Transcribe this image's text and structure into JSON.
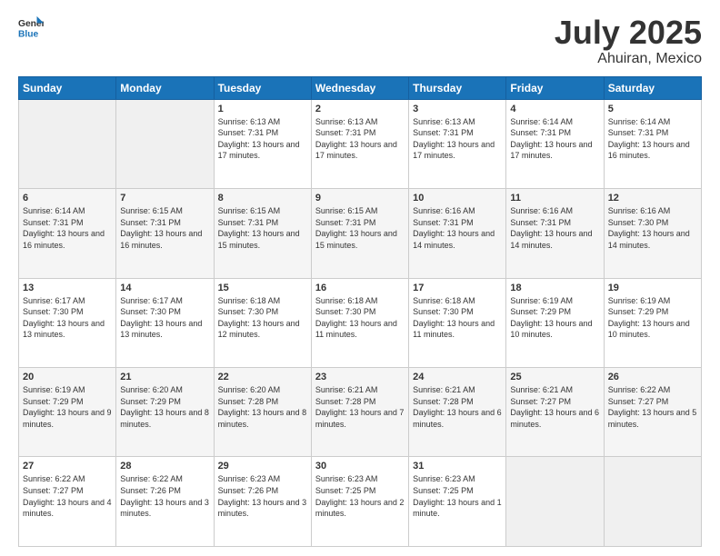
{
  "logo": {
    "general": "General",
    "blue": "Blue"
  },
  "header": {
    "month": "July 2025",
    "location": "Ahuiran, Mexico"
  },
  "weekdays": [
    "Sunday",
    "Monday",
    "Tuesday",
    "Wednesday",
    "Thursday",
    "Friday",
    "Saturday"
  ],
  "weeks": [
    [
      {
        "day": "",
        "sunrise": "",
        "sunset": "",
        "daylight": ""
      },
      {
        "day": "",
        "sunrise": "",
        "sunset": "",
        "daylight": ""
      },
      {
        "day": "1",
        "sunrise": "Sunrise: 6:13 AM",
        "sunset": "Sunset: 7:31 PM",
        "daylight": "Daylight: 13 hours and 17 minutes."
      },
      {
        "day": "2",
        "sunrise": "Sunrise: 6:13 AM",
        "sunset": "Sunset: 7:31 PM",
        "daylight": "Daylight: 13 hours and 17 minutes."
      },
      {
        "day": "3",
        "sunrise": "Sunrise: 6:13 AM",
        "sunset": "Sunset: 7:31 PM",
        "daylight": "Daylight: 13 hours and 17 minutes."
      },
      {
        "day": "4",
        "sunrise": "Sunrise: 6:14 AM",
        "sunset": "Sunset: 7:31 PM",
        "daylight": "Daylight: 13 hours and 17 minutes."
      },
      {
        "day": "5",
        "sunrise": "Sunrise: 6:14 AM",
        "sunset": "Sunset: 7:31 PM",
        "daylight": "Daylight: 13 hours and 16 minutes."
      }
    ],
    [
      {
        "day": "6",
        "sunrise": "Sunrise: 6:14 AM",
        "sunset": "Sunset: 7:31 PM",
        "daylight": "Daylight: 13 hours and 16 minutes."
      },
      {
        "day": "7",
        "sunrise": "Sunrise: 6:15 AM",
        "sunset": "Sunset: 7:31 PM",
        "daylight": "Daylight: 13 hours and 16 minutes."
      },
      {
        "day": "8",
        "sunrise": "Sunrise: 6:15 AM",
        "sunset": "Sunset: 7:31 PM",
        "daylight": "Daylight: 13 hours and 15 minutes."
      },
      {
        "day": "9",
        "sunrise": "Sunrise: 6:15 AM",
        "sunset": "Sunset: 7:31 PM",
        "daylight": "Daylight: 13 hours and 15 minutes."
      },
      {
        "day": "10",
        "sunrise": "Sunrise: 6:16 AM",
        "sunset": "Sunset: 7:31 PM",
        "daylight": "Daylight: 13 hours and 14 minutes."
      },
      {
        "day": "11",
        "sunrise": "Sunrise: 6:16 AM",
        "sunset": "Sunset: 7:31 PM",
        "daylight": "Daylight: 13 hours and 14 minutes."
      },
      {
        "day": "12",
        "sunrise": "Sunrise: 6:16 AM",
        "sunset": "Sunset: 7:30 PM",
        "daylight": "Daylight: 13 hours and 14 minutes."
      }
    ],
    [
      {
        "day": "13",
        "sunrise": "Sunrise: 6:17 AM",
        "sunset": "Sunset: 7:30 PM",
        "daylight": "Daylight: 13 hours and 13 minutes."
      },
      {
        "day": "14",
        "sunrise": "Sunrise: 6:17 AM",
        "sunset": "Sunset: 7:30 PM",
        "daylight": "Daylight: 13 hours and 13 minutes."
      },
      {
        "day": "15",
        "sunrise": "Sunrise: 6:18 AM",
        "sunset": "Sunset: 7:30 PM",
        "daylight": "Daylight: 13 hours and 12 minutes."
      },
      {
        "day": "16",
        "sunrise": "Sunrise: 6:18 AM",
        "sunset": "Sunset: 7:30 PM",
        "daylight": "Daylight: 13 hours and 11 minutes."
      },
      {
        "day": "17",
        "sunrise": "Sunrise: 6:18 AM",
        "sunset": "Sunset: 7:30 PM",
        "daylight": "Daylight: 13 hours and 11 minutes."
      },
      {
        "day": "18",
        "sunrise": "Sunrise: 6:19 AM",
        "sunset": "Sunset: 7:29 PM",
        "daylight": "Daylight: 13 hours and 10 minutes."
      },
      {
        "day": "19",
        "sunrise": "Sunrise: 6:19 AM",
        "sunset": "Sunset: 7:29 PM",
        "daylight": "Daylight: 13 hours and 10 minutes."
      }
    ],
    [
      {
        "day": "20",
        "sunrise": "Sunrise: 6:19 AM",
        "sunset": "Sunset: 7:29 PM",
        "daylight": "Daylight: 13 hours and 9 minutes."
      },
      {
        "day": "21",
        "sunrise": "Sunrise: 6:20 AM",
        "sunset": "Sunset: 7:29 PM",
        "daylight": "Daylight: 13 hours and 8 minutes."
      },
      {
        "day": "22",
        "sunrise": "Sunrise: 6:20 AM",
        "sunset": "Sunset: 7:28 PM",
        "daylight": "Daylight: 13 hours and 8 minutes."
      },
      {
        "day": "23",
        "sunrise": "Sunrise: 6:21 AM",
        "sunset": "Sunset: 7:28 PM",
        "daylight": "Daylight: 13 hours and 7 minutes."
      },
      {
        "day": "24",
        "sunrise": "Sunrise: 6:21 AM",
        "sunset": "Sunset: 7:28 PM",
        "daylight": "Daylight: 13 hours and 6 minutes."
      },
      {
        "day": "25",
        "sunrise": "Sunrise: 6:21 AM",
        "sunset": "Sunset: 7:27 PM",
        "daylight": "Daylight: 13 hours and 6 minutes."
      },
      {
        "day": "26",
        "sunrise": "Sunrise: 6:22 AM",
        "sunset": "Sunset: 7:27 PM",
        "daylight": "Daylight: 13 hours and 5 minutes."
      }
    ],
    [
      {
        "day": "27",
        "sunrise": "Sunrise: 6:22 AM",
        "sunset": "Sunset: 7:27 PM",
        "daylight": "Daylight: 13 hours and 4 minutes."
      },
      {
        "day": "28",
        "sunrise": "Sunrise: 6:22 AM",
        "sunset": "Sunset: 7:26 PM",
        "daylight": "Daylight: 13 hours and 3 minutes."
      },
      {
        "day": "29",
        "sunrise": "Sunrise: 6:23 AM",
        "sunset": "Sunset: 7:26 PM",
        "daylight": "Daylight: 13 hours and 3 minutes."
      },
      {
        "day": "30",
        "sunrise": "Sunrise: 6:23 AM",
        "sunset": "Sunset: 7:25 PM",
        "daylight": "Daylight: 13 hours and 2 minutes."
      },
      {
        "day": "31",
        "sunrise": "Sunrise: 6:23 AM",
        "sunset": "Sunset: 7:25 PM",
        "daylight": "Daylight: 13 hours and 1 minute."
      },
      {
        "day": "",
        "sunrise": "",
        "sunset": "",
        "daylight": ""
      },
      {
        "day": "",
        "sunrise": "",
        "sunset": "",
        "daylight": ""
      }
    ]
  ]
}
